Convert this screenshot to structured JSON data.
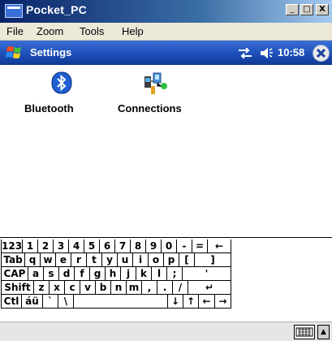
{
  "window": {
    "title": "Pocket_PC",
    "controls": {
      "minimize": "_",
      "maximize": "□",
      "close": "X"
    }
  },
  "menu": [
    "File",
    "Zoom",
    "Tools",
    "Help"
  ],
  "navbar": {
    "title": "Settings",
    "time": "10:58",
    "icons": [
      "windows-start-icon",
      "connectivity-arrows-icon",
      "speaker-icon",
      "close-icon"
    ]
  },
  "settings": [
    {
      "label": "Bluetooth",
      "icon": "bluetooth-icon"
    },
    {
      "label": "Connections",
      "icon": "connections-icon"
    }
  ],
  "keyboard": {
    "rows": [
      [
        "123",
        "1",
        "2",
        "3",
        "4",
        "5",
        "6",
        "7",
        "8",
        "9",
        "0",
        "-",
        "=",
        "←"
      ],
      [
        "Tab",
        "q",
        "w",
        "e",
        "r",
        "t",
        "y",
        "u",
        "i",
        "o",
        "p",
        "[",
        "]"
      ],
      [
        "CAP",
        "a",
        "s",
        "d",
        "f",
        "g",
        "h",
        "j",
        "k",
        "l",
        ";",
        "'"
      ],
      [
        "Shift",
        "z",
        "x",
        "c",
        "v",
        "b",
        "n",
        "m",
        ",",
        ".",
        "/",
        "↵"
      ],
      [
        "Ctl",
        "áü",
        "`",
        "\\",
        "",
        "↓",
        "↑",
        "←",
        "→"
      ]
    ]
  },
  "colors": {
    "titlebar": "#0a246a",
    "navbar": "#1d4fb8",
    "menubar": "#ece9d8"
  }
}
